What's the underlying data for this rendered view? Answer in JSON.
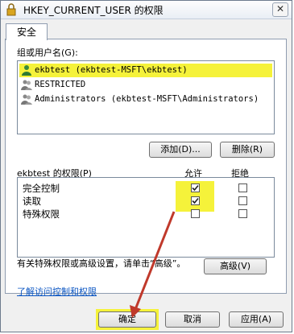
{
  "window": {
    "title": "HKEY_CURRENT_USER 的权限",
    "close_label": "✕"
  },
  "tab": {
    "label": "安全"
  },
  "groups": {
    "label": "组或用户名(G):",
    "items": [
      {
        "name": "ekbtest (ekbtest-MSFT\\ekbtest)",
        "selected": true
      },
      {
        "name": "RESTRICTED",
        "selected": false
      },
      {
        "name": "Administrators (ekbtest-MSFT\\Administrators)",
        "selected": false
      }
    ],
    "add_label": "添加(D)...",
    "remove_label": "删除(R)"
  },
  "permissions": {
    "title": "ekbtest 的权限(P)",
    "allow_header": "允许",
    "deny_header": "拒绝",
    "rows": [
      {
        "label": "完全控制",
        "allow": true,
        "deny": false
      },
      {
        "label": "读取",
        "allow": true,
        "deny": false
      },
      {
        "label": "特殊权限",
        "allow": false,
        "deny": false
      }
    ]
  },
  "advanced": {
    "text": "有关特殊权限或高级设置，请单击“高级”。",
    "button_label": "高级(V)"
  },
  "link": {
    "label": "了解访问控制和权限"
  },
  "footer": {
    "ok_label": "确定",
    "cancel_label": "取消",
    "apply_label": "应用(A)"
  },
  "colors": {
    "highlight": "#f5f23a",
    "arrow": "#c0392b"
  }
}
